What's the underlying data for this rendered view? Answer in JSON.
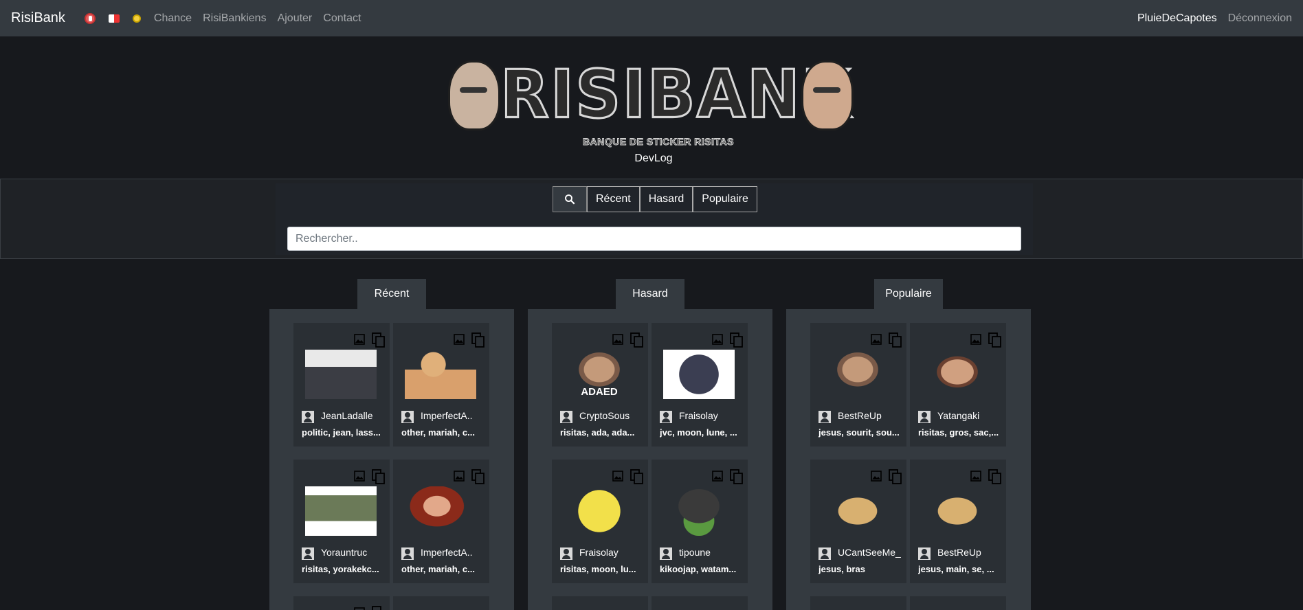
{
  "navbar": {
    "brand": "RisiBank",
    "icons": [
      "hand-icon",
      "domino-icon",
      "yellow-dot-icon"
    ],
    "links": [
      "Chance",
      "RisiBankiens",
      "Ajouter",
      "Contact"
    ],
    "user": "PluieDeCapotes",
    "logout": "Déconnexion"
  },
  "header": {
    "logo_text": "RISIBANK",
    "logo_subtitle": "BANQUE DE STICKER RISITAS",
    "devlog": "DevLog"
  },
  "search": {
    "tabs": [
      "Récent",
      "Hasard",
      "Populaire"
    ],
    "placeholder": "Rechercher.."
  },
  "columns": [
    {
      "title": "Récent",
      "cards": [
        {
          "author": "JeanLadalle",
          "tags": "politic, jean, lass..."
        },
        {
          "author": "ImperfectA..",
          "tags": "other, mariah, c..."
        },
        {
          "author": "Yorauntruc",
          "tags": "risitas, yorakekc..."
        },
        {
          "author": "ImperfectA..",
          "tags": "other, mariah, c..."
        }
      ]
    },
    {
      "title": "Hasard",
      "cards": [
        {
          "author": "CryptoSous",
          "tags": "risitas, ada, ada...",
          "caption": "ADAED"
        },
        {
          "author": "Fraisolay",
          "tags": "jvc, moon, lune, ..."
        },
        {
          "author": "Fraisolay",
          "tags": "risitas, moon, lu..."
        },
        {
          "author": "tipoune",
          "tags": "kikoojap, watam..."
        }
      ]
    },
    {
      "title": "Populaire",
      "cards": [
        {
          "author": "BestReUp",
          "tags": "jesus, sourit, sou..."
        },
        {
          "author": "Yatangaki",
          "tags": "risitas, gros, sac,..."
        },
        {
          "author": "UCantSeeMe_",
          "tags": "jesus, bras"
        },
        {
          "author": "BestReUp",
          "tags": "jesus, main, se, ..."
        }
      ]
    }
  ],
  "colors": {
    "navbar_bg": "#343a40",
    "page_bg": "#17191d",
    "panel_bg": "#343a40"
  }
}
